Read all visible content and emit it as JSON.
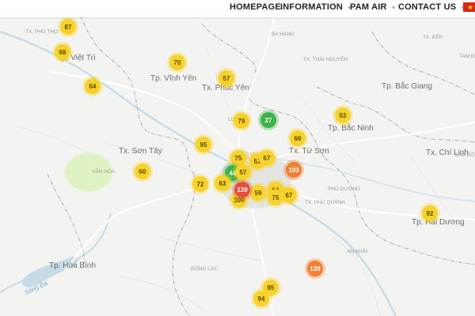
{
  "nav": {
    "items": [
      {
        "label": "HOMEPAGE"
      },
      {
        "label": "INFORMATION",
        "dropdown": true
      },
      {
        "label": "PAM AIR",
        "dropdown": true
      },
      {
        "label": "CONTACT US",
        "dropdown": true
      }
    ],
    "language_flag": "vietnam-flag-icon"
  },
  "colors": {
    "good": "#3cb44b",
    "moderate": "#f7d22a",
    "unhealthy_sensitive": "#f07f33",
    "unhealthy": "#e4513b",
    "water": "#c5dbe8",
    "park": "#dff2c2"
  },
  "places": [
    {
      "name": "Tx. Phú Thọ",
      "size": "sm"
    },
    {
      "name": "Tp. Việt Trì",
      "size": "lg"
    },
    {
      "name": "Ba Hàng",
      "size": "sm"
    },
    {
      "name": "Tp. Vĩnh Yên",
      "size": "lg"
    },
    {
      "name": "Tx. Phúc Yên",
      "size": "lg"
    },
    {
      "name": "Tx. Thái Nguyên",
      "size": "sm"
    },
    {
      "name": "Tx. Kép",
      "size": "sm"
    },
    {
      "name": "Tam Đ",
      "size": "sm"
    },
    {
      "name": "Tp. Bắc Giang",
      "size": "lg"
    },
    {
      "name": "Tp. Bắc Ninh",
      "size": "lg"
    },
    {
      "name": "Tx. Từ Sơn",
      "size": "lg"
    },
    {
      "name": "Tx. Sơn Tây",
      "size": "lg"
    },
    {
      "name": "Vân Hòa",
      "size": "sm"
    },
    {
      "name": "Tx. Chí Linh",
      "size": "lg"
    },
    {
      "name": "Sao Đỏ",
      "size": "sm"
    },
    {
      "name": "Tp. Hải Dương",
      "size": "lg"
    },
    {
      "name": "Tp. Hòa Bình",
      "size": "lg"
    },
    {
      "name": "Sông Đà",
      "size": "river"
    },
    {
      "name": "Đông Lạc",
      "size": "sm"
    },
    {
      "name": "An Khải",
      "size": "sm"
    },
    {
      "name": "Tx. Phú Quỳnh",
      "size": "sm"
    },
    {
      "name": "Phú Dương",
      "size": "sm"
    },
    {
      "name": "Lương",
      "size": "sm"
    }
  ],
  "markers": [
    {
      "value": "87",
      "level": "moderate"
    },
    {
      "value": "88",
      "level": "moderate"
    },
    {
      "value": "64",
      "level": "moderate"
    },
    {
      "value": "70",
      "level": "moderate"
    },
    {
      "value": "57",
      "level": "moderate"
    },
    {
      "value": "79",
      "level": "moderate"
    },
    {
      "value": "27",
      "level": "good"
    },
    {
      "value": "53",
      "level": "moderate"
    },
    {
      "value": "66",
      "level": "moderate"
    },
    {
      "value": "95",
      "level": "moderate"
    },
    {
      "value": "75",
      "level": "moderate"
    },
    {
      "value": "52",
      "level": "moderate"
    },
    {
      "value": "67",
      "level": "moderate"
    },
    {
      "value": "103",
      "level": "unhealthy_sensitive"
    },
    {
      "value": "60",
      "level": "moderate"
    },
    {
      "value": "44",
      "level": "good"
    },
    {
      "value": "72",
      "level": "moderate"
    },
    {
      "value": "63",
      "level": "moderate"
    },
    {
      "value": "57",
      "level": "moderate"
    },
    {
      "value": "64",
      "level": "moderate"
    },
    {
      "value": "75",
      "level": "moderate"
    },
    {
      "value": "67",
      "level": "moderate"
    },
    {
      "value": "59",
      "level": "moderate"
    },
    {
      "value": "100",
      "level": "moderate"
    },
    {
      "value": "139",
      "level": "unhealthy"
    },
    {
      "value": "92",
      "level": "moderate"
    },
    {
      "value": "139",
      "level": "unhealthy_sensitive"
    },
    {
      "value": "95",
      "level": "moderate"
    },
    {
      "value": "94",
      "level": "moderate"
    }
  ]
}
